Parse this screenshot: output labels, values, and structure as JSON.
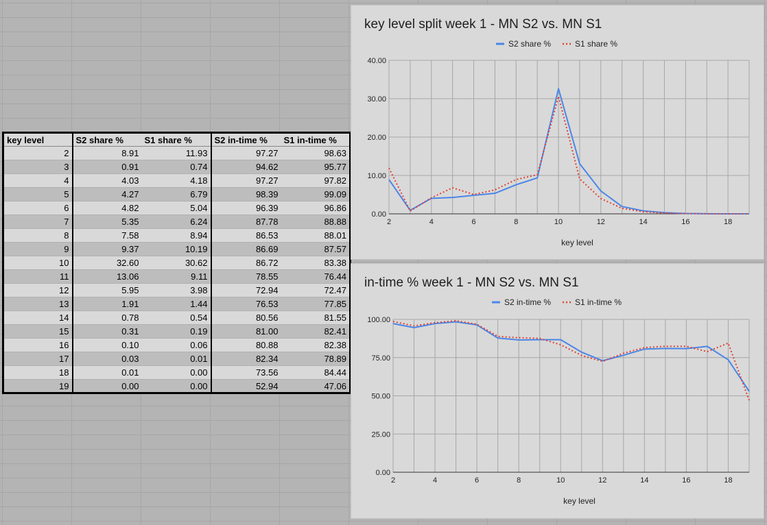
{
  "table": {
    "headers": [
      "key level",
      "S2 share %",
      "S1 share %",
      "S2 in-time %",
      "S1 in-time %"
    ],
    "rows": [
      [
        "2",
        "8.91",
        "11.93",
        "97.27",
        "98.63"
      ],
      [
        "3",
        "0.91",
        "0.74",
        "94.62",
        "95.77"
      ],
      [
        "4",
        "4.03",
        "4.18",
        "97.27",
        "97.82"
      ],
      [
        "5",
        "4.27",
        "6.79",
        "98.39",
        "99.09"
      ],
      [
        "6",
        "4.82",
        "5.04",
        "96.39",
        "96.86"
      ],
      [
        "7",
        "5.35",
        "6.24",
        "87.78",
        "88.88"
      ],
      [
        "8",
        "7.58",
        "8.94",
        "86.53",
        "88.01"
      ],
      [
        "9",
        "9.37",
        "10.19",
        "86.69",
        "87.57"
      ],
      [
        "10",
        "32.60",
        "30.62",
        "86.72",
        "83.38"
      ],
      [
        "11",
        "13.06",
        "9.11",
        "78.55",
        "76.44"
      ],
      [
        "12",
        "5.95",
        "3.98",
        "72.94",
        "72.47"
      ],
      [
        "13",
        "1.91",
        "1.44",
        "76.53",
        "77.85"
      ],
      [
        "14",
        "0.78",
        "0.54",
        "80.56",
        "81.55"
      ],
      [
        "15",
        "0.31",
        "0.19",
        "81.00",
        "82.41"
      ],
      [
        "16",
        "0.10",
        "0.06",
        "80.88",
        "82.38"
      ],
      [
        "17",
        "0.03",
        "0.01",
        "82.34",
        "78.89"
      ],
      [
        "18",
        "0.01",
        "0.00",
        "73.56",
        "84.44"
      ],
      [
        "19",
        "0.00",
        "0.00",
        "52.94",
        "47.06"
      ]
    ]
  },
  "colors": {
    "s2_line": "#4a86e8",
    "s1_line": "#e0402f",
    "grid": "#a6a6a6",
    "panel": "#d9d9d9"
  },
  "chart_data": [
    {
      "type": "line",
      "title": "key level split week 1 - MN S2 vs. MN S1",
      "xlabel": "key level",
      "ylabel": "",
      "x": [
        2,
        3,
        4,
        5,
        6,
        7,
        8,
        9,
        10,
        11,
        12,
        13,
        14,
        15,
        16,
        17,
        18,
        19
      ],
      "xlim": [
        2,
        19
      ],
      "ylim": [
        0,
        40
      ],
      "xticks": [
        "2",
        "4",
        "6",
        "8",
        "10",
        "12",
        "14",
        "16",
        "18"
      ],
      "yticks": [
        "0.00",
        "10.00",
        "20.00",
        "30.00",
        "40.00"
      ],
      "legend_position": "top-center",
      "grid": true,
      "series": [
        {
          "name": "S2 share %",
          "style": "solid",
          "values": [
            8.91,
            0.91,
            4.03,
            4.27,
            4.82,
            5.35,
            7.58,
            9.37,
            32.6,
            13.06,
            5.95,
            1.91,
            0.78,
            0.31,
            0.1,
            0.03,
            0.01,
            0.0
          ]
        },
        {
          "name": "S1 share %",
          "style": "dotted",
          "values": [
            11.93,
            0.74,
            4.18,
            6.79,
            5.04,
            6.24,
            8.94,
            10.19,
            30.62,
            9.11,
            3.98,
            1.44,
            0.54,
            0.19,
            0.06,
            0.01,
            0.0,
            0.0
          ]
        }
      ]
    },
    {
      "type": "line",
      "title": "in-time % week 1 - MN S2 vs. MN S1",
      "xlabel": "key level",
      "ylabel": "",
      "x": [
        2,
        3,
        4,
        5,
        6,
        7,
        8,
        9,
        10,
        11,
        12,
        13,
        14,
        15,
        16,
        17,
        18,
        19
      ],
      "xlim": [
        2,
        19
      ],
      "ylim": [
        0,
        100
      ],
      "xticks": [
        "2",
        "4",
        "6",
        "8",
        "10",
        "12",
        "14",
        "16",
        "18"
      ],
      "yticks": [
        "0.00",
        "25.00",
        "50.00",
        "75.00",
        "100.00"
      ],
      "legend_position": "top-center",
      "grid": true,
      "series": [
        {
          "name": "S2 in-time %",
          "style": "solid",
          "values": [
            97.27,
            94.62,
            97.27,
            98.39,
            96.39,
            87.78,
            86.53,
            86.69,
            86.72,
            78.55,
            72.94,
            76.53,
            80.56,
            81.0,
            80.88,
            82.34,
            73.56,
            52.94
          ]
        },
        {
          "name": "S1 in-time %",
          "style": "dotted",
          "values": [
            98.63,
            95.77,
            97.82,
            99.09,
            96.86,
            88.88,
            88.01,
            87.57,
            83.38,
            76.44,
            72.47,
            77.85,
            81.55,
            82.41,
            82.38,
            78.89,
            84.44,
            47.06
          ]
        }
      ]
    }
  ]
}
